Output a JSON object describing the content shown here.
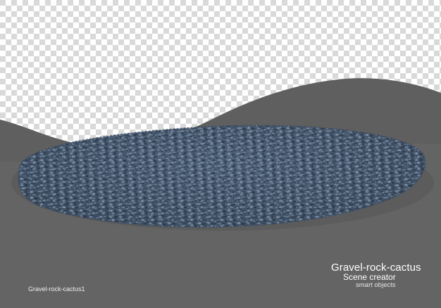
{
  "image": {
    "title": "Gravel-rock-cactus",
    "subtitle": "Scene creator",
    "tagline": "smart objects",
    "filename": "Gravel-rock-cactus1"
  },
  "colors": {
    "checker_light": "#ffffff",
    "checker_dark": "#d9d9d9",
    "terrain_back": "#5f5f5f",
    "terrain_front": "#646464",
    "gravel_base": "#4a5f78",
    "gravel_highlight": "#8aa1bb",
    "gravel_shadow": "#26354a",
    "text": "#ffffff"
  },
  "icons": {
    "background": "transparency-checkerboard",
    "object": "gravel-patch"
  }
}
